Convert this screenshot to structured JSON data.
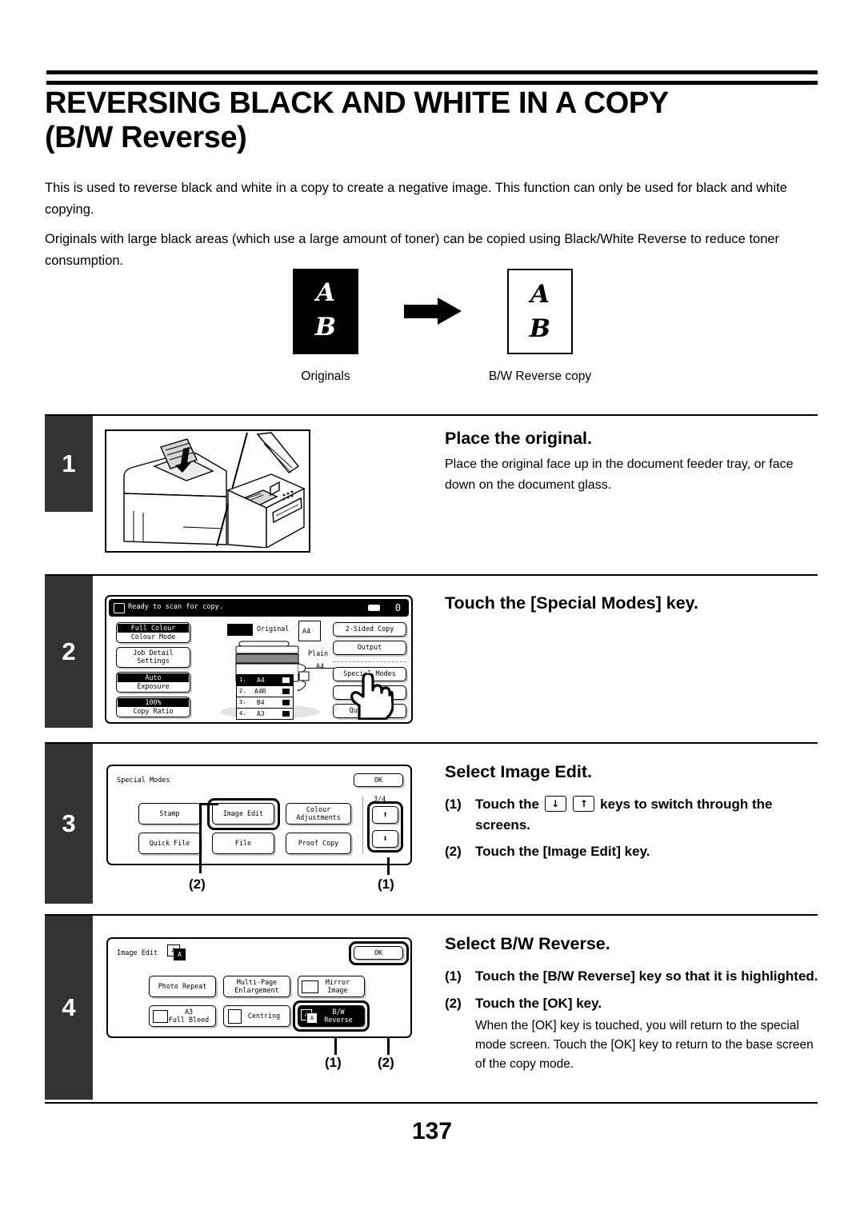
{
  "page": {
    "number": "137",
    "title_line1": "REVERSING BLACK AND WHITE IN A COPY",
    "title_line2": "(B/W Reverse)",
    "intro_p1": "This is used to reverse black and white in a copy to create a negative image. This function can only be used for black and white copying.",
    "intro_p2": "Originals with large black areas (which use a large amount of toner) can be copied using Black/White Reverse to reduce toner consumption."
  },
  "figure": {
    "glyph_a": "A",
    "glyph_b": "B",
    "caption_original": "Originals",
    "caption_copy": "B/W Reverse copy"
  },
  "steps": [
    {
      "number": "1",
      "title": "Place the original.",
      "body": "Place the original face up in the document feeder tray, or face down on the document glass."
    },
    {
      "number": "2",
      "title": "Touch the [Special Modes] key."
    },
    {
      "number": "3",
      "title": "Select Image Edit.",
      "items": [
        {
          "n": "(1)",
          "text_a": "Touch the",
          "text_b": "keys to switch through the screens."
        },
        {
          "n": "(2)",
          "text_a": "Touch the [Image Edit] key."
        }
      ]
    },
    {
      "number": "4",
      "title": "Select B/W Reverse.",
      "items": [
        {
          "n": "(1)",
          "text": "Touch the [B/W Reverse] key so that it is highlighted."
        },
        {
          "n": "(2)",
          "text": "Touch the [OK] key."
        }
      ],
      "note": "When the [OK] key is touched, you will return to the special mode screen. Touch the [OK] key to return to the base screen of the copy mode."
    }
  ],
  "screen_copy_base": {
    "status_text": "Ready to scan for copy.",
    "copy_count": "0",
    "left_keys": [
      {
        "top": "Full Colour",
        "bottom": "Colour Mode",
        "inverted_top": true
      },
      {
        "top": "Job Detail",
        "bottom": "Settings",
        "inverted_top": false
      },
      {
        "top": "Auto",
        "bottom": "Exposure",
        "inverted_top": true
      },
      {
        "top": "100%",
        "bottom": "Copy Ratio",
        "inverted_top": true
      }
    ],
    "right_keys": [
      "2-Sided Copy",
      "Output",
      "Special Modes",
      "File",
      "Quick File"
    ],
    "original_label": "Original",
    "original_size": "A4",
    "paper_type": "Plain",
    "paper_size": "A4",
    "trays": [
      {
        "n": "1.",
        "size": "A4",
        "selected": true
      },
      {
        "n": "2.",
        "size": "A4R",
        "selected": false
      },
      {
        "n": "3.",
        "size": "B4",
        "selected": false
      },
      {
        "n": "4.",
        "size": "A3",
        "selected": false
      }
    ]
  },
  "screen_special_modes": {
    "title": "Special Modes",
    "ok_label": "OK",
    "page_indicator": "3/4",
    "keys": [
      "Stamp",
      "Image Edit",
      "Colour Adjustments",
      "Quick File",
      "File",
      "Proof Copy"
    ],
    "selected_key": "Image Edit",
    "callout_left": "(2)",
    "callout_right": "(1)"
  },
  "screen_image_edit": {
    "title": "Image Edit",
    "ok_label": "OK",
    "keys": [
      "Photo Repeat",
      "Multi-Page Enlargement",
      "Mirror Image",
      "A3 Full Bleed",
      "Centring",
      "B/W Reverse"
    ],
    "selected_key": "B/W Reverse",
    "callout_left": "(1)",
    "callout_right": "(2)"
  }
}
